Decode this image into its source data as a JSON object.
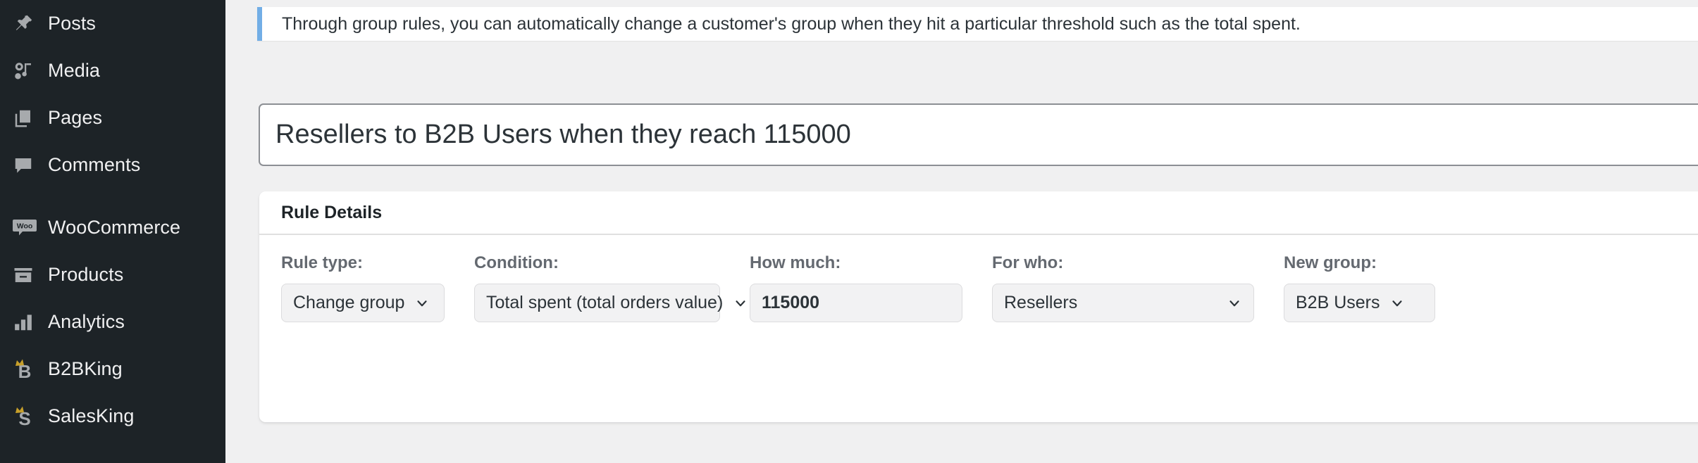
{
  "sidebar": {
    "background": "#1d2327",
    "items": [
      {
        "label": "Posts",
        "icon": "pin-icon"
      },
      {
        "label": "Media",
        "icon": "media-icon"
      },
      {
        "label": "Pages",
        "icon": "pages-icon"
      },
      {
        "label": "Comments",
        "icon": "comment-bubble-icon"
      },
      {
        "label": "WooCommerce",
        "icon": "woocommerce-icon"
      },
      {
        "label": "Products",
        "icon": "products-box-icon"
      },
      {
        "label": "Analytics",
        "icon": "bar-chart-icon"
      },
      {
        "label": "B2BKing",
        "icon": "b2bking-crown-icon"
      },
      {
        "label": "SalesKing",
        "icon": "salesking-crown-icon"
      }
    ]
  },
  "notice": {
    "text": "Through group rules, you can automatically change a customer's group when they hit a particular threshold such as the total spent.",
    "accent_color": "#72aee6"
  },
  "title_field": {
    "value": "Resellers to B2B Users when they reach 115000",
    "placeholder": "Add title"
  },
  "rule_card": {
    "header": "Rule Details",
    "fields": {
      "rule_type": {
        "label": "Rule type:",
        "value": "Change group"
      },
      "condition": {
        "label": "Condition:",
        "value": "Total spent (total orders value)"
      },
      "how_much": {
        "label": "How much:",
        "value": "115000",
        "placeholder": ""
      },
      "for_who": {
        "label": "For who:",
        "value": "Resellers"
      },
      "new_group": {
        "label": "New group:",
        "value": "B2B Users"
      }
    }
  }
}
